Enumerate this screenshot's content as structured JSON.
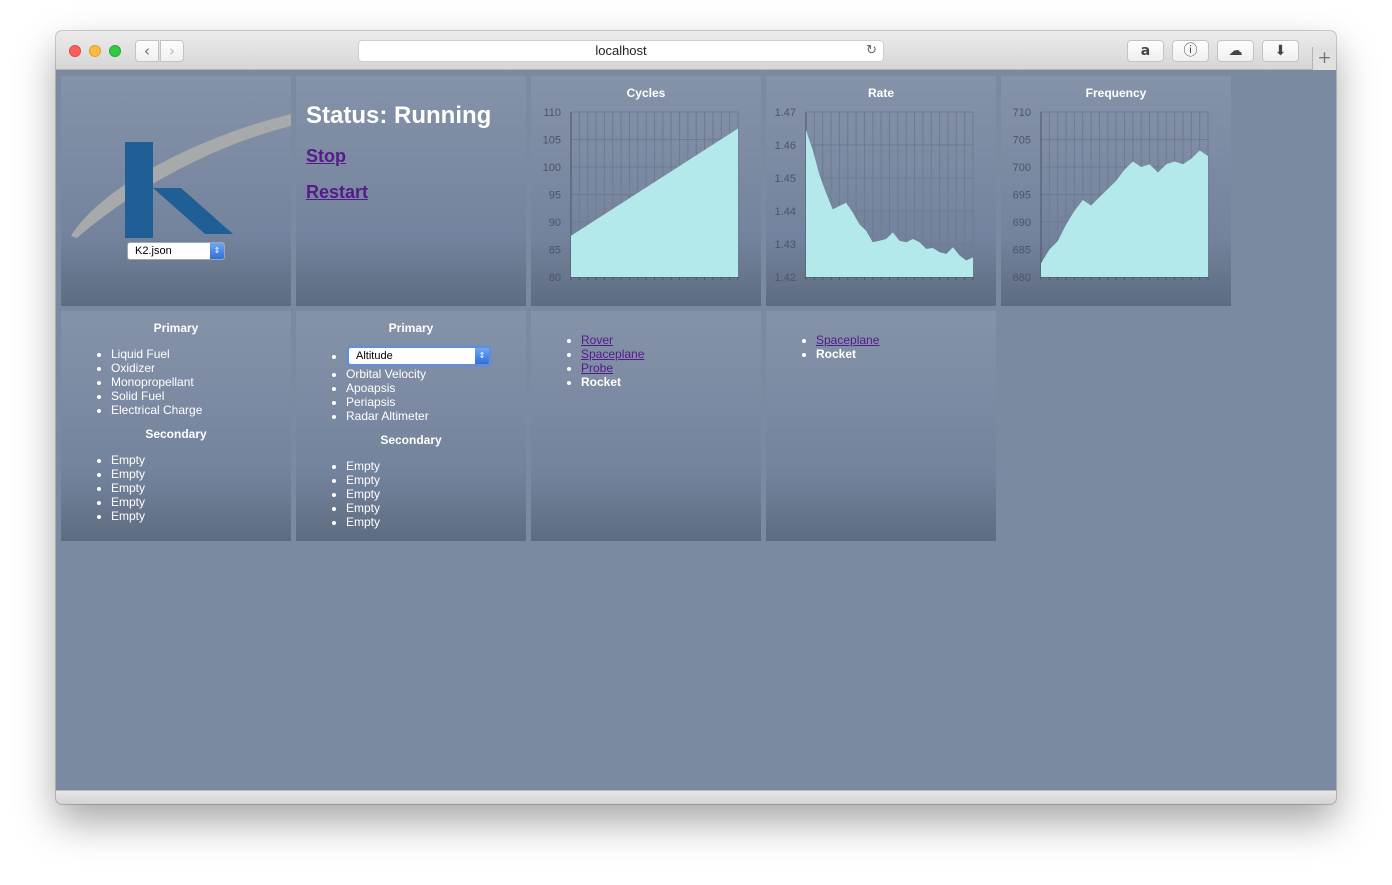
{
  "browser": {
    "url": "localhost",
    "icons": {
      "back": "chevron-left-icon",
      "forward": "chevron-right-icon",
      "reload": "reload-icon",
      "amazon": "amazon-icon",
      "password": "onepassword-icon",
      "cloud": "cloud-icon",
      "download": "download-icon",
      "newtab": "plus-icon"
    }
  },
  "logo_panel": {
    "config_select": "K2.json",
    "colors": {
      "k_blue": "#1f5f95",
      "swoosh": "#a7a9ab"
    }
  },
  "status_panel": {
    "status": "Status: Running",
    "stop": "Stop",
    "restart": "Restart"
  },
  "chart_data": [
    {
      "type": "area",
      "title": "Cycles",
      "ylim": [
        80,
        110
      ],
      "yticks": [
        "110",
        "105",
        "100",
        "95",
        "90",
        "85",
        "80"
      ],
      "x": [
        0,
        1
      ],
      "values": [
        87.5,
        107.0
      ],
      "fill": "#b3e9ea"
    },
    {
      "type": "area",
      "title": "Rate",
      "ylim": [
        1.42,
        1.47
      ],
      "yticks": [
        "1.47",
        "1.46",
        "1.45",
        "1.44",
        "1.43",
        "1.42"
      ],
      "x": [
        0,
        0.04,
        0.08,
        0.12,
        0.16,
        0.2,
        0.24,
        0.28,
        0.32,
        0.36,
        0.4,
        0.44,
        0.48,
        0.52,
        0.56,
        0.6,
        0.64,
        0.68,
        0.72,
        0.76,
        0.8,
        0.84,
        0.88,
        0.92,
        0.96,
        1.0
      ],
      "values": [
        1.4645,
        1.4585,
        1.451,
        1.4455,
        1.4405,
        1.4415,
        1.4425,
        1.4395,
        1.436,
        1.434,
        1.4305,
        1.431,
        1.4315,
        1.4335,
        1.431,
        1.4305,
        1.4315,
        1.4305,
        1.4285,
        1.4288,
        1.4275,
        1.427,
        1.429,
        1.4265,
        1.425,
        1.426
      ],
      "fill": "#b3e9ea"
    },
    {
      "type": "area",
      "title": "Frequency",
      "ylim": [
        680,
        710
      ],
      "yticks": [
        "710",
        "705",
        "700",
        "695",
        "690",
        "685",
        "680"
      ],
      "x": [
        0,
        0.05,
        0.1,
        0.15,
        0.2,
        0.25,
        0.3,
        0.35,
        0.4,
        0.45,
        0.5,
        0.55,
        0.6,
        0.65,
        0.7,
        0.75,
        0.8,
        0.85,
        0.9,
        0.95,
        1.0
      ],
      "values": [
        682.5,
        685,
        686.5,
        689.5,
        692,
        694,
        693,
        694.5,
        696,
        697.5,
        699.5,
        701,
        700,
        700.5,
        699,
        700.5,
        701,
        700.5,
        701.5,
        703,
        702
      ],
      "fill": "#b3e9ea"
    }
  ],
  "resources_panel": {
    "primary_heading": "Primary",
    "primary_items": [
      "Liquid Fuel",
      "Oxidizer",
      "Monopropellant",
      "Solid Fuel",
      "Electrical Charge"
    ],
    "secondary_heading": "Secondary",
    "secondary_items": [
      "Empty",
      "Empty",
      "Empty",
      "Empty",
      "Empty"
    ]
  },
  "telemetry_panel": {
    "primary_heading": "Primary",
    "selected": "Altitude",
    "primary_items": [
      "Orbital Velocity",
      "Apoapsis",
      "Periapsis",
      "Radar Altimeter"
    ],
    "secondary_heading": "Secondary",
    "secondary_items": [
      "Empty",
      "Empty",
      "Empty",
      "Empty",
      "Empty"
    ]
  },
  "vessel_list_1": {
    "links": [
      "Rover",
      "Spaceplane",
      "Probe"
    ],
    "current": "Rocket"
  },
  "vessel_list_2": {
    "links": [
      "Spaceplane"
    ],
    "current": "Rocket"
  }
}
